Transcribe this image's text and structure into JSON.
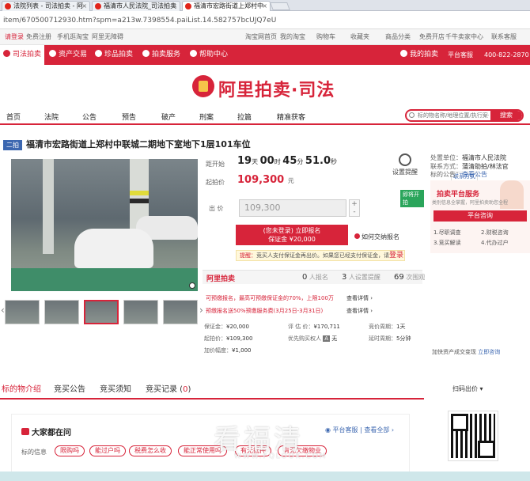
{
  "browser": {
    "tabs": [
      {
        "label": "法院列表 - 司法拍卖 - 阿"
      },
      {
        "label": "福清市人民法院_司法拍卖"
      },
      {
        "label": "福清市宏路街道上郑村中"
      }
    ],
    "url": "item/670500712930.htm?spm=a213w.7398554.paiList.14.582757bcUJQ7eU"
  },
  "toplinks": {
    "login": "请登录",
    "register": "免费注册",
    "mobile": "手机逛淘宝",
    "wuzhang": "阿里无障碍",
    "home": "淘宝网首页",
    "my_taobao": "我的淘宝",
    "cart": "购物车",
    "fav": "收藏夹",
    "category": "商品分类",
    "free_shop": "免费开店",
    "seller": "千牛卖家中心",
    "contact": "联系客服"
  },
  "rednav": {
    "items": [
      "司法拍卖",
      "资产交易",
      "珍品拍卖",
      "拍卖服务",
      "帮助中心"
    ],
    "my_auction": "我的拍卖",
    "platform_service": "平台客服",
    "phone": "400-822-2870"
  },
  "logo": {
    "text": "阿里拍卖·司法"
  },
  "mainnav": {
    "items": [
      "首页",
      "法院",
      "公告",
      "预告",
      "破产",
      "刑案",
      "拉篇",
      "精准获客"
    ],
    "search_placeholder": "标的物名称/地理位置/执行案号",
    "search_button": "搜索"
  },
  "item": {
    "badge": "二拍",
    "title": "福清市宏路街道上郑村中联城二期地下室地下1层101车位"
  },
  "bid": {
    "countdown_label": "距开始",
    "days": "19",
    "days_unit": "天",
    "hours": "00",
    "hours_unit": "时",
    "minutes": "45",
    "minutes_unit": "分",
    "seconds": "51.0",
    "seconds_unit": "秒",
    "remind_label": "设置提醒",
    "start_price_label": "起拍价",
    "start_price": "109,300",
    "price_unit": "元",
    "green_badge": "即将开拍",
    "bid_label": "出 价",
    "bid_value": "109,300",
    "plus": "+",
    "minus": "-",
    "signup_line1": "(您未登录) 立即报名",
    "signup_line2": "保证金 ¥20,000",
    "howto": "如何交纳报名",
    "tip_prefix": "提醒：",
    "tip_text": "竞买人支付保证金再出价。如果您已经支付保证金，请",
    "tip_login": "登录"
  },
  "stats": {
    "brand": "阿里拍卖",
    "signups": "0",
    "signups_label": "人报名",
    "reminders": "3",
    "reminders_label": "人设置提醒",
    "views": "69",
    "views_label": "次围观"
  },
  "promos": [
    {
      "text": "可预缴报名，最高可预缴保证金的70%，上限100万",
      "detail": "查看详情 ›"
    },
    {
      "text": "预缴报名送50%预缴服务费(3月25日-3月31日)",
      "detail": "查看详情 ›"
    }
  ],
  "info": {
    "deposit_label": "保证金：",
    "deposit": "¥20,000",
    "appraisal_label": "评 估 价：",
    "appraisal": "¥170,711",
    "period_label": "竞价周期：",
    "period": "1天",
    "increment_label": "加价幅度：",
    "increment": "¥1,000",
    "priority_label": "优先购买权人",
    "priority_icon": "A",
    "priority": "无",
    "start_label": "起拍价：",
    "start": "¥109,300",
    "delay_label": "延时周期：",
    "delay": "5分钟",
    "add_asset": "加快资产成交变现",
    "add_asset_link": "立即咨询"
  },
  "side": {
    "unit_label": "处置单位：",
    "unit": "福清市人民法院",
    "contact_label": "联系方式：",
    "contact": "蒲清助拍/林法官",
    "contact_btn": "联系方式",
    "notice_label": "标的公告：",
    "notice_link": "查看公告",
    "svc_title": "拍卖平台服务",
    "svc_desc": "类别信息全掌握，阿里拍卖助您全程",
    "svc_button": "平台咨询",
    "svc_items": [
      "1.尽职调查",
      "2.财税咨询",
      "3.竞买解读",
      "4.代办过户"
    ]
  },
  "tabs": {
    "items": [
      "标的物介绍",
      "竞买公告",
      "竞买须知"
    ],
    "record_label": "竞买记录 (",
    "record_count": "0",
    "record_close": ")",
    "qr_label": "扫码出价"
  },
  "ask": {
    "title": "大家都在问",
    "platform": "平台客服",
    "sep": "|",
    "view_all": "查看全部 ›",
    "tag_label": "标的信息",
    "tags": [
      "限购吗",
      "能过户吗",
      "税费怎么收",
      "能正常使用吗",
      "有无抵押",
      "有无欠缴物业"
    ]
  },
  "watermark": {
    "main": "看福清",
    "sub": "WWW.FQLOOK.COM"
  }
}
